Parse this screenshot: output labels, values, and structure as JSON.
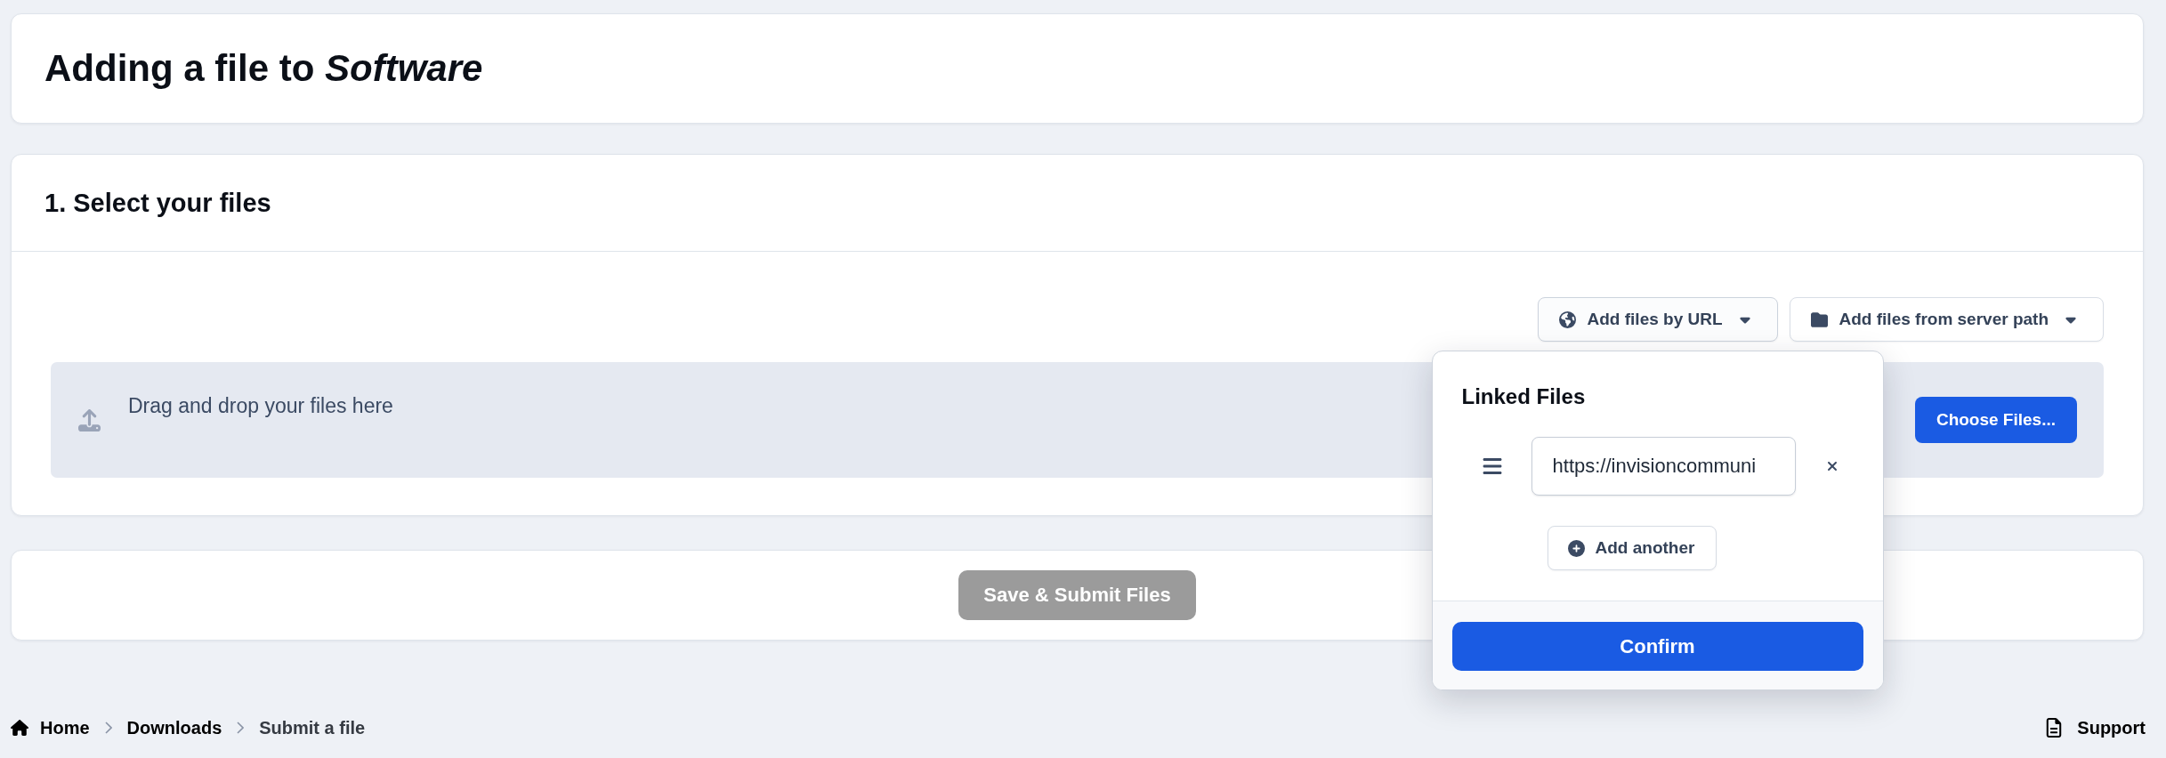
{
  "header": {
    "title": "Adding a file to *Software*"
  },
  "section": {
    "title": "1. Select your files",
    "actions": [
      {
        "kind": "url",
        "label": "Add files by URL",
        "expanded": true,
        "menu": {
          "title": "Linked Files",
          "rows": [
            {
              "value": "https://invisioncommuni"
            }
          ],
          "add_label": "Add another",
          "confirm_label": "Confirm"
        }
      },
      {
        "kind": "path",
        "label": "Add files from server path",
        "expanded": false
      }
    ],
    "dropzone": {
      "text": "Drag and drop your files here",
      "button": "Choose Files..."
    }
  },
  "submit": {
    "label": "Save & Submit Files",
    "disabled": true
  },
  "breadcrumb": [
    {
      "kind": "home",
      "label": "Home",
      "current": false
    },
    {
      "kind": "link",
      "label": "Downloads",
      "current": false
    },
    {
      "kind": "link",
      "label": "Submit a file",
      "current": true
    }
  ],
  "footer": {
    "support": {
      "label": "Support"
    }
  }
}
